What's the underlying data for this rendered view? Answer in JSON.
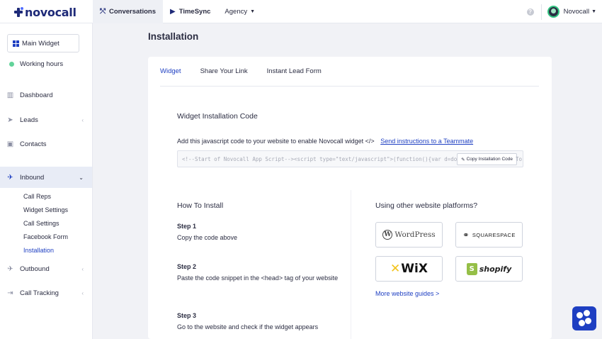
{
  "brand": {
    "name": "novocall"
  },
  "topnav": {
    "conversations": "Conversations",
    "timesync": "TimeSync",
    "agency": "Agency"
  },
  "user": {
    "name": "Novocall"
  },
  "sidebar": {
    "main_widget": "Main Widget",
    "working_hours": "Working hours",
    "items": {
      "dashboard": "Dashboard",
      "leads": "Leads",
      "contacts": "Contacts",
      "inbound": "Inbound",
      "outbound": "Outbound",
      "call_tracking": "Call Tracking"
    },
    "inbound_sub": {
      "call_reps": "Call Reps",
      "widget_settings": "Widget Settings",
      "call_settings": "Call Settings",
      "facebook_form": "Facebook Form",
      "installation": "Installation"
    }
  },
  "page": {
    "title": "Installation"
  },
  "tabs": {
    "widget": "Widget",
    "share_link": "Share Your Link",
    "instant_form": "Instant Lead Form"
  },
  "install": {
    "title": "Widget Installation Code",
    "description": "Add this javascript code to your website to enable Novocall widget </>",
    "send_link": "Send instructions to a Teammate",
    "code": "<!--Start of Novocall App Script--><script type=\"text/javascript\">(function(){var d=document,",
    "code_tail": "To",
    "copy_button": "Copy Installation Code"
  },
  "how_to": {
    "title": "How To Install",
    "step1_label": "Step 1",
    "step1_text": "Copy the code above",
    "step2_label": "Step 2",
    "step2_text": "Paste the code snippet in the <head> tag of your website",
    "step3_label": "Step 3",
    "step3_text": "Go to the website and check if the widget appears"
  },
  "platforms": {
    "title": "Using other website platforms?",
    "wordpress": "WordPress",
    "squarespace": "SQUARESPACE",
    "wix": "WiX",
    "shopify": "shopify",
    "more_guides": "More website guides >"
  },
  "colors": {
    "accent": "#1e3fc2",
    "brand_dark": "#1e2a78",
    "status_green": "#62d39a"
  }
}
